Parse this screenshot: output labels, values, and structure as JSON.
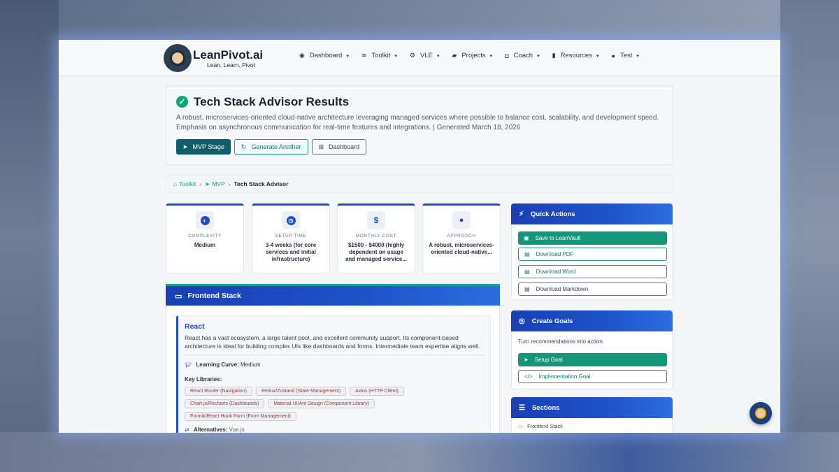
{
  "brand": {
    "name": "LeanPivot.ai",
    "tagline": "Lean, Learn, Pivot"
  },
  "nav": [
    {
      "label": "Dashboard",
      "icon": "dashboard-icon"
    },
    {
      "label": "Toolkit",
      "icon": "layers-icon"
    },
    {
      "label": "VLE",
      "icon": "cogs-icon"
    },
    {
      "label": "Projects",
      "icon": "folder-icon"
    },
    {
      "label": "Coach",
      "icon": "robot-icon"
    },
    {
      "label": "Resources",
      "icon": "book-icon"
    },
    {
      "label": "Test",
      "icon": "user-icon"
    }
  ],
  "result": {
    "title": "Tech Stack Advisor Results",
    "description": "A robust, microservices-oriented cloud-native architecture leveraging managed services where possible to balance cost, scalability, and development speed. Emphasis on asynchronous communication for real-time features and integrations. | Generated March 18, 2026",
    "buttons": {
      "mvp": "MVP Stage",
      "generate": "Generate Another",
      "dashboard": "Dashboard"
    }
  },
  "breadcrumb": {
    "toolkit": "Toolkit",
    "mvp": "MVP",
    "current": "Tech Stack Advisor"
  },
  "stats": [
    {
      "label": "COMPLEXITY",
      "value": "Medium",
      "icon": "gauge-icon",
      "glyph": "◐"
    },
    {
      "label": "SETUP TIME",
      "value": "3-4 weeks (for core services and initial infrastructure)",
      "icon": "clock-icon",
      "glyph": "◷"
    },
    {
      "label": "MONTHLY COST",
      "value": "$1500 - $4000 (highly dependent on usage and managed service...",
      "icon": "dollar-icon",
      "glyph": "$"
    },
    {
      "label": "APPROACH",
      "value": "A robust, microservices-oriented cloud-native...",
      "icon": "lightbulb-icon",
      "glyph": "●"
    }
  ],
  "frontend": {
    "heading": "Frontend Stack",
    "name": "React",
    "description": "React has a vast ecosystem, a large talent pool, and excellent community support. Its component-based architecture is ideal for building complex UIs like dashboards and forms. Intermediate team expertise aligns well.",
    "learning_curve_label": "Learning Curve:",
    "learning_curve_value": "Medium",
    "key_libraries_label": "Key Libraries:",
    "libraries": [
      "React Router (Navigation)",
      "Redux/Zustand (State Management)",
      "Axios (HTTP Client)",
      "Chart.js/Recharts (Dashboards)",
      "Material-UI/Ant Design (Component Library)",
      "Formik/React Hook Form (Form Management)"
    ],
    "alternatives_label": "Alternatives:",
    "alternatives_value": "Vue.js"
  },
  "quick_actions": {
    "heading": "Quick Actions",
    "save": "Save to LeanVault",
    "pdf": "Download PDF",
    "word": "Download Word",
    "markdown": "Download Markdown"
  },
  "goals": {
    "heading": "Create Goals",
    "text": "Turn recommendations into action:",
    "setup": "Setup Goal",
    "implementation": "Implementation Goal"
  },
  "sections": {
    "heading": "Sections",
    "first": "Frontend Stack"
  }
}
